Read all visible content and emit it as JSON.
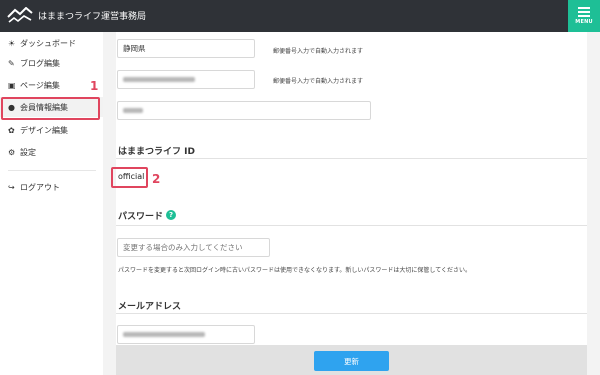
{
  "header": {
    "site_title": "はままつライフ運営事務局",
    "menu_label": "MENU"
  },
  "sidebar": {
    "items": [
      {
        "label": "ダッシュボード",
        "icon": "dashboard-icon"
      },
      {
        "label": "ブログ編集",
        "icon": "pencil-icon"
      },
      {
        "label": "ページ編集",
        "icon": "pages-icon"
      },
      {
        "label": "会員情報編集",
        "icon": "user-icon"
      },
      {
        "label": "デザイン編集",
        "icon": "palette-icon"
      },
      {
        "label": "設定",
        "icon": "gear-icon"
      },
      {
        "label": "ログアウト",
        "icon": "logout-icon"
      }
    ]
  },
  "annotations": {
    "mark1": "1",
    "mark2": "2",
    "color": "#e0455e"
  },
  "form": {
    "prefecture_value": "静岡県",
    "postal_note": "郵便番号入力で自動入力されます",
    "address_note": "郵便番号入力で自動入力されます",
    "id_heading": "はままつライフ ID",
    "id_value": "official",
    "password_heading": "パスワード",
    "password_placeholder": "変更する場合のみ入力してください",
    "password_note": "パスワードを変更すると次回ログイン時に古いパスワードは使用できなくなります。新しいパスワードは大切に保管してください。",
    "email_heading": "メールアドレス"
  },
  "actions": {
    "update_label": "更新"
  },
  "colors": {
    "topbar": "#2f3237",
    "menu_accent": "#1ebf96",
    "button_blue": "#2fa3ef",
    "annotation_red": "#e0455e"
  }
}
